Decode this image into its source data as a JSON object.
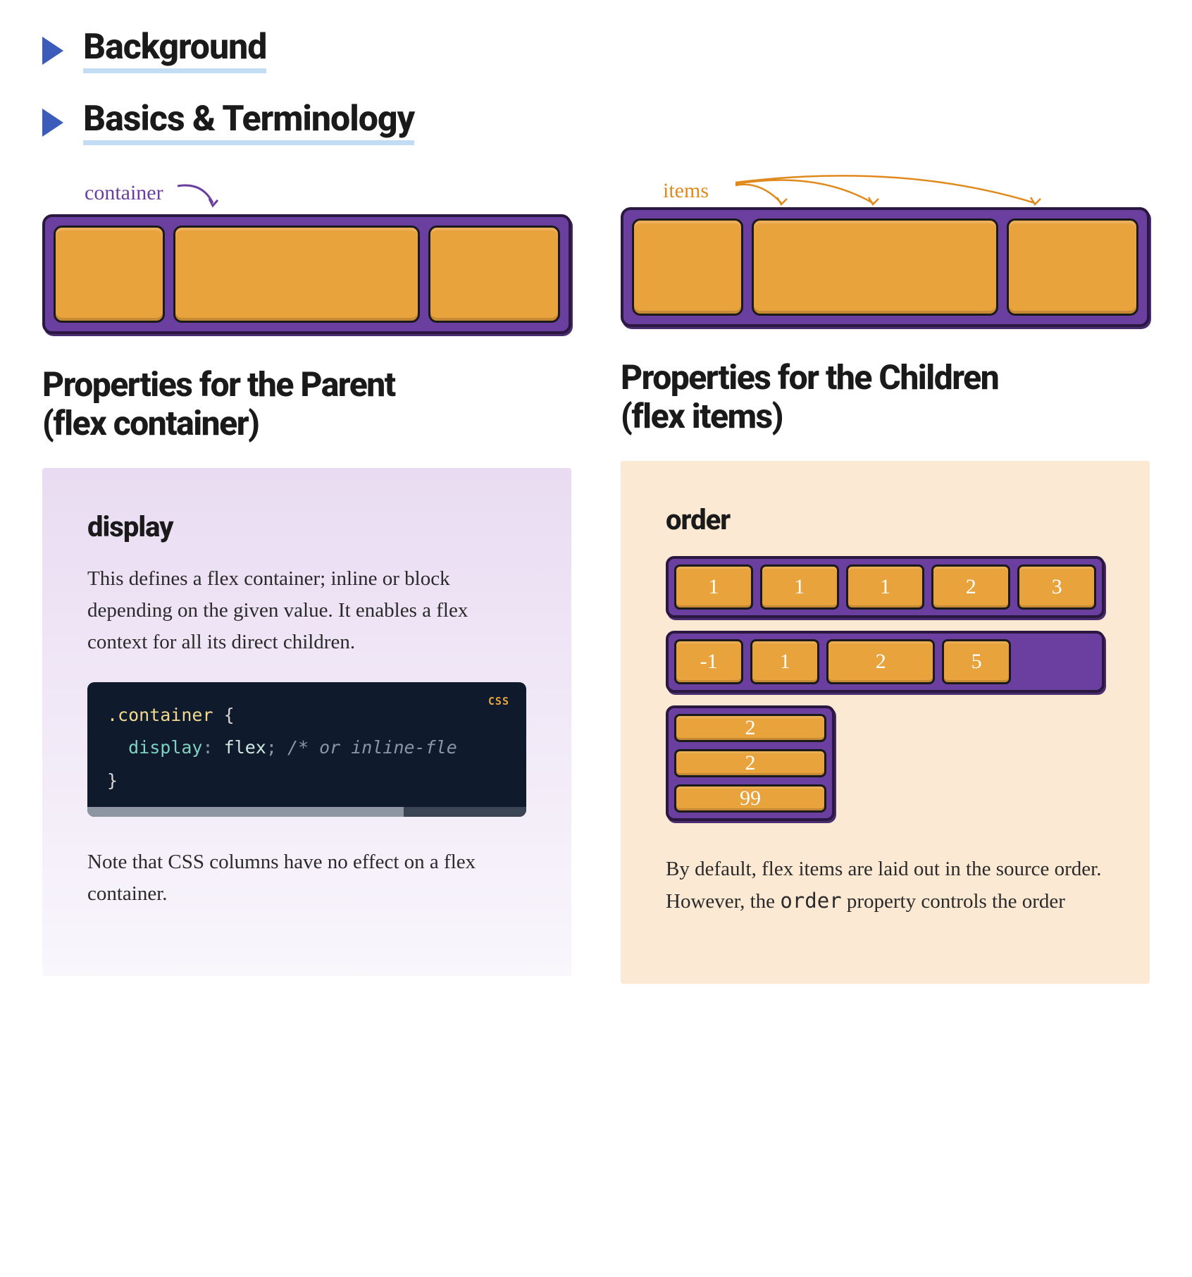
{
  "nav": {
    "background": "Background",
    "basics": "Basics & Terminology"
  },
  "left": {
    "diagram_label": "container",
    "heading": "Properties for the Parent\n(flex container)",
    "prop": {
      "title": "display",
      "desc": "This defines a flex container; inline or block depending on the given value. It enables a flex context for all its direct children.",
      "code": {
        "lang": "CSS",
        "selector": ".container",
        "property": "display",
        "value": "flex",
        "comment": "/* or inline-fle"
      },
      "note": "Note that CSS columns have no effect on a flex container."
    }
  },
  "right": {
    "diagram_label": "items",
    "heading": "Properties for the Children\n(flex items)",
    "prop": {
      "title": "order",
      "rows": {
        "r1": [
          "1",
          "1",
          "1",
          "2",
          "3"
        ],
        "r2": [
          "-1",
          "1",
          "2",
          "5"
        ],
        "r3": [
          "2",
          "2",
          "99"
        ]
      },
      "desc_start": "By default, flex items are laid out in the source order. However, the ",
      "desc_code": "order",
      "desc_end": " property controls the order"
    }
  }
}
